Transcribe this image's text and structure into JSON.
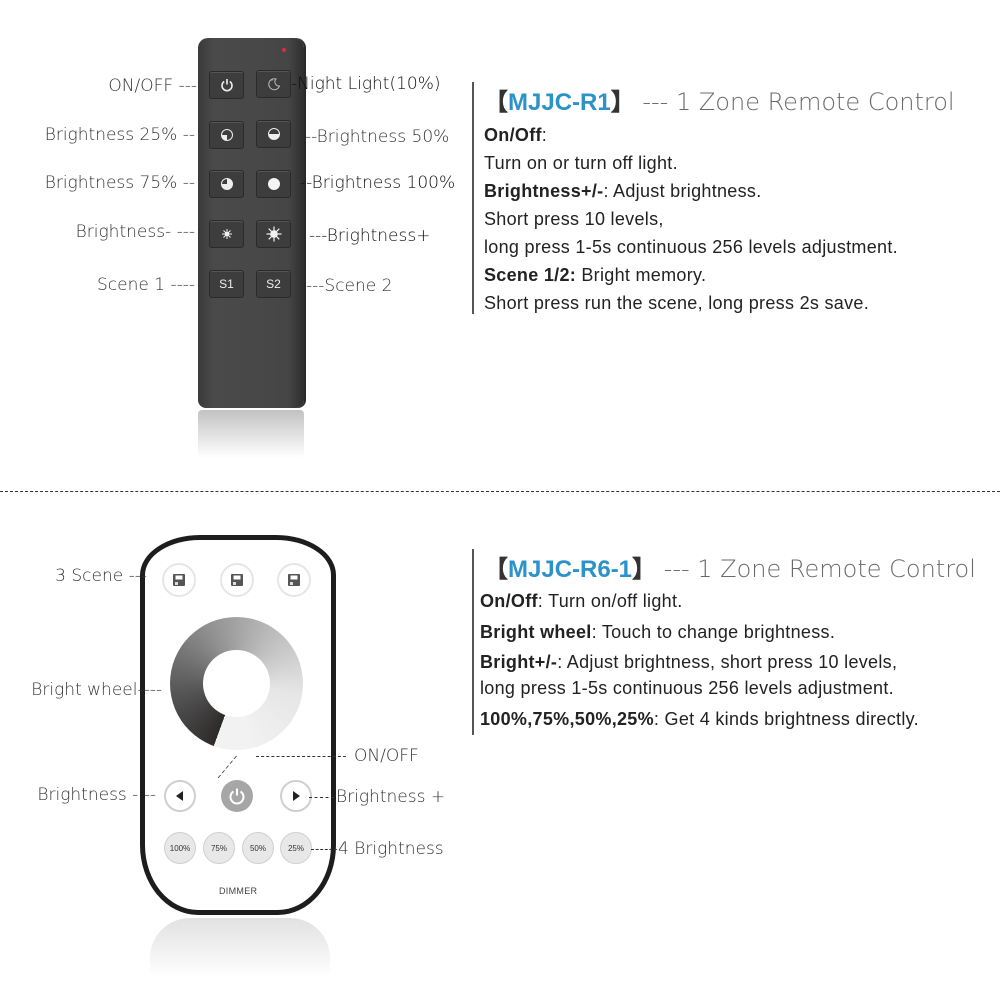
{
  "remote_r1": {
    "buttons": {
      "on_off": {
        "icon": "power-icon"
      },
      "night_light": {
        "icon": "moon-icon"
      },
      "brightness_25": {
        "icon": "quarter-circle-icon"
      },
      "brightness_50": {
        "icon": "half-circle-icon"
      },
      "brightness_75": {
        "icon": "three-quarter-circle-icon"
      },
      "brightness_100": {
        "icon": "full-circle-icon"
      },
      "brightness_minus": {
        "icon": "small-sun-icon"
      },
      "brightness_plus": {
        "icon": "large-sun-icon"
      },
      "scene_1": {
        "label": "S1"
      },
      "scene_2": {
        "label": "S2"
      }
    },
    "labels": {
      "on_off": "ON/OFF ---",
      "night_light": "-Night Light(10%)",
      "brightness_25": "Brightness 25% --",
      "brightness_50": "--Brightness 50%",
      "brightness_75": "Brightness 75% --",
      "brightness_100": "--Brightness 100%",
      "brightness_minus": "Brightness- ---",
      "brightness_plus": "---Brightness+",
      "scene_1": "Scene 1 ----",
      "scene_2": "---Scene 2"
    }
  },
  "description_r1": {
    "bracket_open": "【",
    "model": "MJJC-R1",
    "bracket_close": "】",
    "subtitle": "--- 1 Zone Remote Control",
    "lines": [
      {
        "bold": "On/Off",
        "text": ":"
      },
      {
        "bold": "",
        "text": "Turn on or turn off light."
      },
      {
        "bold": "Brightness+/-",
        "text": ": Adjust brightness."
      },
      {
        "bold": "",
        "text": "Short press 10 levels,"
      },
      {
        "bold": "",
        "text": "long press 1-5s continuous 256 levels adjustment."
      },
      {
        "bold": "Scene 1/2:",
        "text": " Bright memory."
      },
      {
        "bold": "",
        "text": "Short press run the scene, long press 2s save."
      }
    ]
  },
  "remote_r6": {
    "scene_buttons": [
      {
        "icon": "save-icon"
      },
      {
        "icon": "save-icon"
      },
      {
        "icon": "save-icon"
      }
    ],
    "wheel": {
      "icon": "brightness-wheel"
    },
    "buttons": {
      "brightness_minus": {
        "icon": "triangle-left-icon"
      },
      "on_off": {
        "icon": "power-icon"
      },
      "brightness_plus": {
        "icon": "triangle-right-icon"
      }
    },
    "percent_buttons": [
      "100%",
      "75%",
      "50%",
      "25%"
    ],
    "brand_text": "DIMMER",
    "labels": {
      "scene": "3 Scene ---",
      "wheel": "Bright wheel----",
      "on_off": "ON/OFF",
      "brightness_minus": "Brightness - --",
      "brightness_plus": "Brightness +",
      "four_brightness": "4 Brightness"
    }
  },
  "description_r6": {
    "bracket_open": "【",
    "model": "MJJC-R6-1",
    "bracket_close": "】",
    "subtitle": "--- 1 Zone Remote Control",
    "lines": [
      {
        "bold": "On/Off",
        "text": ": Turn on/off light."
      },
      {
        "bold": "Bright wheel",
        "text": ": Touch to change brightness."
      },
      {
        "bold": "Bright+/-",
        "text": ": Adjust brightness, short press 10 levels,"
      },
      {
        "bold": "",
        "text": "long press 1-5s continuous 256 levels adjustment."
      },
      {
        "bold": "100%,75%,50%,25%",
        "text": ": Get 4 kinds brightness directly."
      }
    ]
  },
  "colors": {
    "model_blue": "#2c93c8",
    "remote_dark": "#464646",
    "led_red": "#d8303a"
  }
}
